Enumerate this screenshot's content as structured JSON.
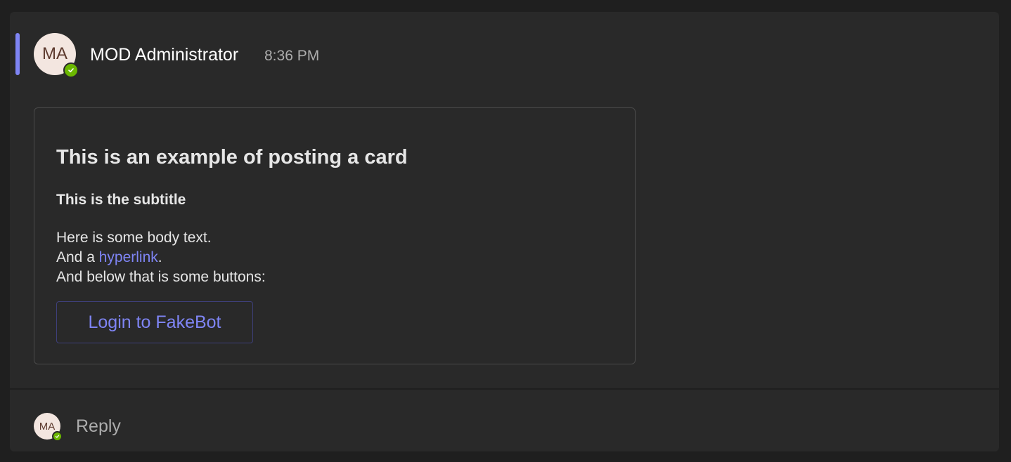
{
  "message": {
    "sender": {
      "initials": "MA",
      "name": "MOD Administrator",
      "presence": "available"
    },
    "timestamp": "8:36 PM",
    "card": {
      "title": "This is an example of posting a card",
      "subtitle": "This is the subtitle",
      "body_line1": "Here is some body text.",
      "body_line2_prefix": "And a ",
      "link_text": "hyperlink",
      "body_line2_suffix": ".",
      "body_line3": "And below that is some buttons:",
      "button_label": "Login to FakeBot"
    }
  },
  "reply": {
    "initials": "MA",
    "label": "Reply"
  },
  "colors": {
    "accent": "#7f85f5",
    "presence_available": "#6bb700",
    "background": "#1f1f1f",
    "surface": "#292929"
  },
  "icons": {
    "presence": "checkmark-icon"
  }
}
